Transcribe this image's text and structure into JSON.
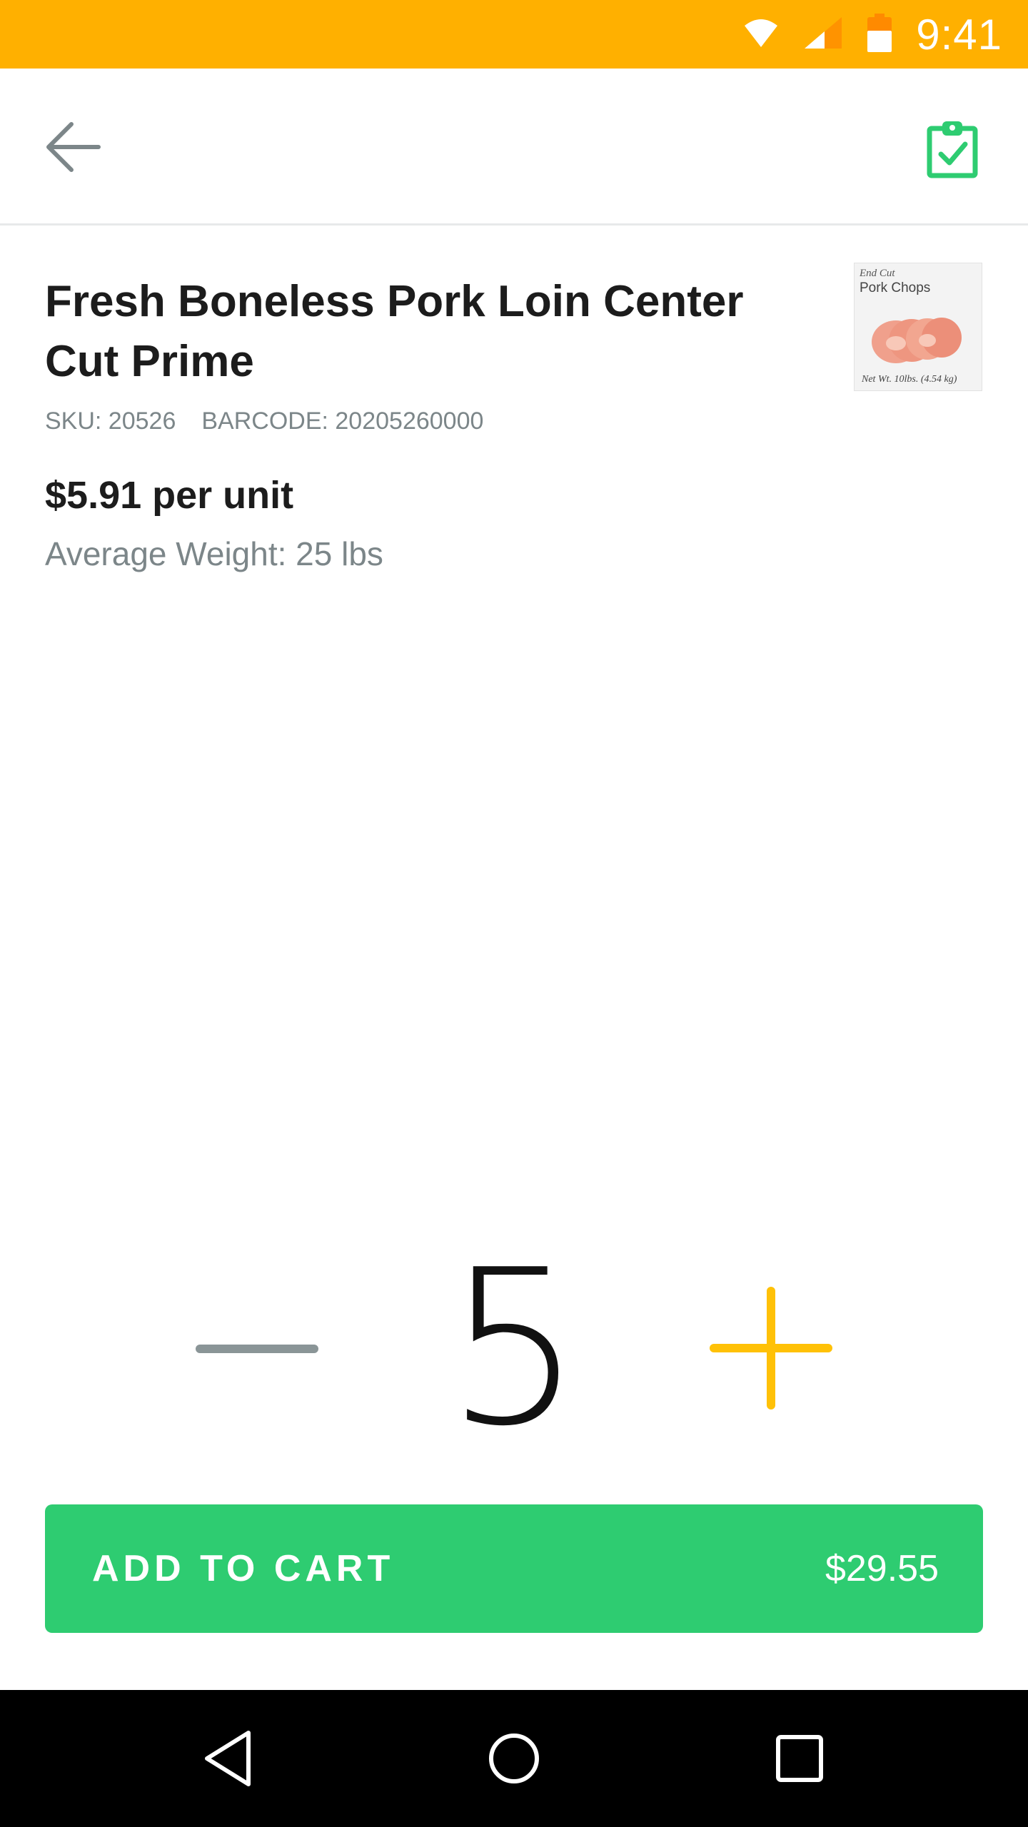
{
  "status_bar": {
    "time": "9:41",
    "background_color": "#FFB000",
    "icons": [
      "wifi-icon",
      "signal-icon",
      "battery-icon"
    ]
  },
  "app_bar": {
    "back_icon": "arrow-left-icon",
    "action_icon": "clipboard-check-icon",
    "action_color": "#2ECC71"
  },
  "product": {
    "title": "Fresh Boneless Pork Loin Center Cut Prime",
    "sku_label": "SKU: 20526",
    "barcode_label": "BARCODE: 20205260000",
    "price": "$5.91 per unit",
    "average_weight": "Average Weight: 25 lbs",
    "thumbnail": {
      "line1": "End Cut",
      "line2": "Pork Chops",
      "line3": "Net Wt. 10lbs. (4.54 kg)"
    }
  },
  "quantity": {
    "value": "5",
    "minus_color": "#8A9597",
    "plus_color": "#FFC107"
  },
  "cart": {
    "label": "ADD TO CART",
    "total": "$29.55",
    "color": "#2ECC71"
  },
  "nav_bar": {
    "buttons": [
      "back-triangle-icon",
      "home-circle-icon",
      "recents-square-icon"
    ]
  }
}
